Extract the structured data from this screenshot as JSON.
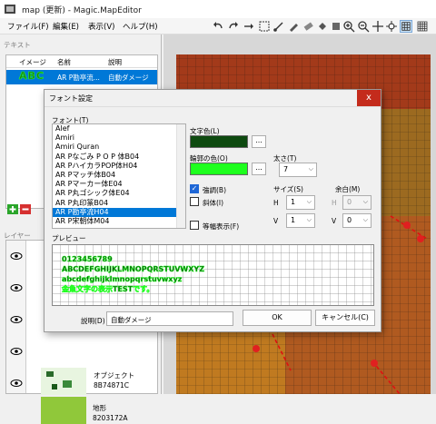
{
  "window": {
    "title": "map (更新) - Magic.MapEditor"
  },
  "menu": [
    "ファイル(F)",
    "編集(E)",
    "表示(V)",
    "ヘルプ(H)"
  ],
  "toolbar_icons": [
    "undo-icon",
    "redo-icon",
    "forward-icon",
    "select-tool-icon",
    "link-tool-icon",
    "pencil-tool-icon",
    "eraser-tool-icon",
    "fill-tool-icon",
    "stamp-tool-icon",
    "grid-check-icon",
    "zoom-in-icon",
    "zoom-out-icon",
    "move-icon",
    "crosshair-icon",
    "grid-icon",
    "grid-dense-icon"
  ],
  "text_panel": {
    "title": "テキスト",
    "columns": [
      "イメージ",
      "名前",
      "説明"
    ],
    "row": {
      "image": "ABC",
      "name": "AR P勘亭流...",
      "desc": "自動ダメージ"
    },
    "colors": {
      "row_highlight": "#0078d7",
      "image_fill": "#1a7a1a",
      "image_outline": "#22ff22"
    }
  },
  "layer_panel": {
    "title": "レイヤー",
    "items": [
      {
        "name": "オブジェクト",
        "id": "8B74871C"
      },
      {
        "name": "地形",
        "id": "8203172A"
      }
    ]
  },
  "dialog": {
    "title": "フォント設定",
    "close": "x",
    "font_label": "フォント(T)",
    "fonts": [
      "Alef",
      "Amiri",
      "Amiri Quran",
      "AR Pなごみ P O P 体B04",
      "AR PハイカラPOP体H04",
      "AR Pマッチ体B04",
      "AR Pマーカー体E04",
      "AR P丸ゴシック体E04",
      "AR P丸印篆B04",
      "AR P勘亭流H04",
      "AR P宋朝体M04"
    ],
    "selected_font_index": 9,
    "text_color_label": "文字色(L)",
    "text_color": "#0e4a10",
    "outline_color_label": "輪郭の色(O)",
    "outline_color": "#1eff1e",
    "thickness_label": "太さ(T)",
    "thickness": "7",
    "bold_label": "強調(B)",
    "bold": true,
    "italic_label": "斜体(I)",
    "italic": false,
    "size_label": "サイズ(S)",
    "h_label": "H",
    "h_size": "1",
    "v_label": "V",
    "v_size": "1",
    "margin_label": "余白(M)",
    "mh_label": "H",
    "h_margin": "0",
    "mv_label": "V",
    "v_margin": "0",
    "monospace_label": "等幅表示(F)",
    "monospace": false,
    "preview_label": "プレビュー",
    "preview_lines": [
      "0123456789",
      "ABCDEFGHIJKLMNOPQRSTUVWXYZ",
      "abcdefghijklmnopqrstuvwxyz",
      "金魚文字の表示TESTです。"
    ],
    "description_label": "説明(D)",
    "description": "自動ダメージ",
    "ok": "OK",
    "cancel": "キャンセル(C)",
    "ellipsis": "...",
    "chevron": "⌵"
  }
}
